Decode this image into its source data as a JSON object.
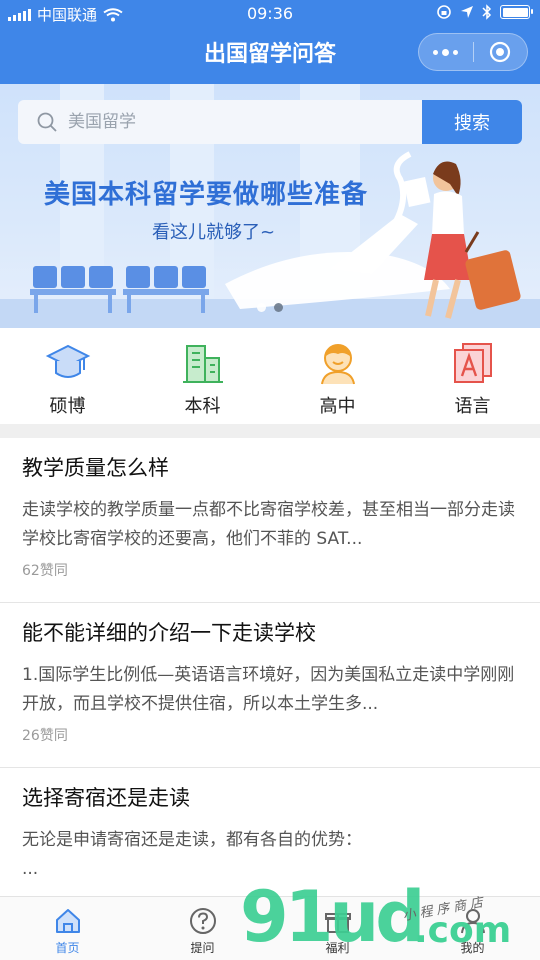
{
  "status_bar": {
    "carrier": "中国联通",
    "time": "09:36"
  },
  "header": {
    "title": "出国留学问答"
  },
  "search": {
    "placeholder": "美国留学",
    "button_label": "搜索"
  },
  "banner": {
    "headline": "美国本科留学要做哪些准备",
    "subline": "看这儿就够了~"
  },
  "categories": [
    {
      "label": "硕博",
      "icon": "graduation-cap-icon"
    },
    {
      "label": "本科",
      "icon": "buildings-icon"
    },
    {
      "label": "高中",
      "icon": "student-face-icon"
    },
    {
      "label": "语言",
      "icon": "letter-a-icon"
    }
  ],
  "articles": [
    {
      "title": "教学质量怎么样",
      "summary": "走读学校的教学质量一点都不比寄宿学校差，甚至相当一部分走读学校比寄宿学校的还要高，他们不菲的 SAT...",
      "likes": "62赞同"
    },
    {
      "title": "能不能详细的介绍一下走读学校",
      "summary": "1.国际学生比例低—英语语言环境好，因为美国私立走读中学刚刚开放，而且学校不提供住宿，所以本土学生多...",
      "likes": "26赞同"
    },
    {
      "title": "选择寄宿还是走读",
      "summary": "无论是申请寄宿还是走读，都有各自的优势：\n...",
      "likes": ""
    }
  ],
  "tabbar": [
    {
      "label": "首页",
      "icon": "home-icon"
    },
    {
      "label": "提问",
      "icon": "question-icon"
    },
    {
      "label": "福利",
      "icon": "gift-icon"
    },
    {
      "label": "我的",
      "icon": "user-icon"
    }
  ],
  "watermark": {
    "brand": "91ud",
    "tagline": "小程序商店",
    "domain": ".com"
  },
  "colors": {
    "primary": "#3f86e8",
    "banner_text": "#2f6fd6",
    "watermark": "#3dcf93"
  }
}
